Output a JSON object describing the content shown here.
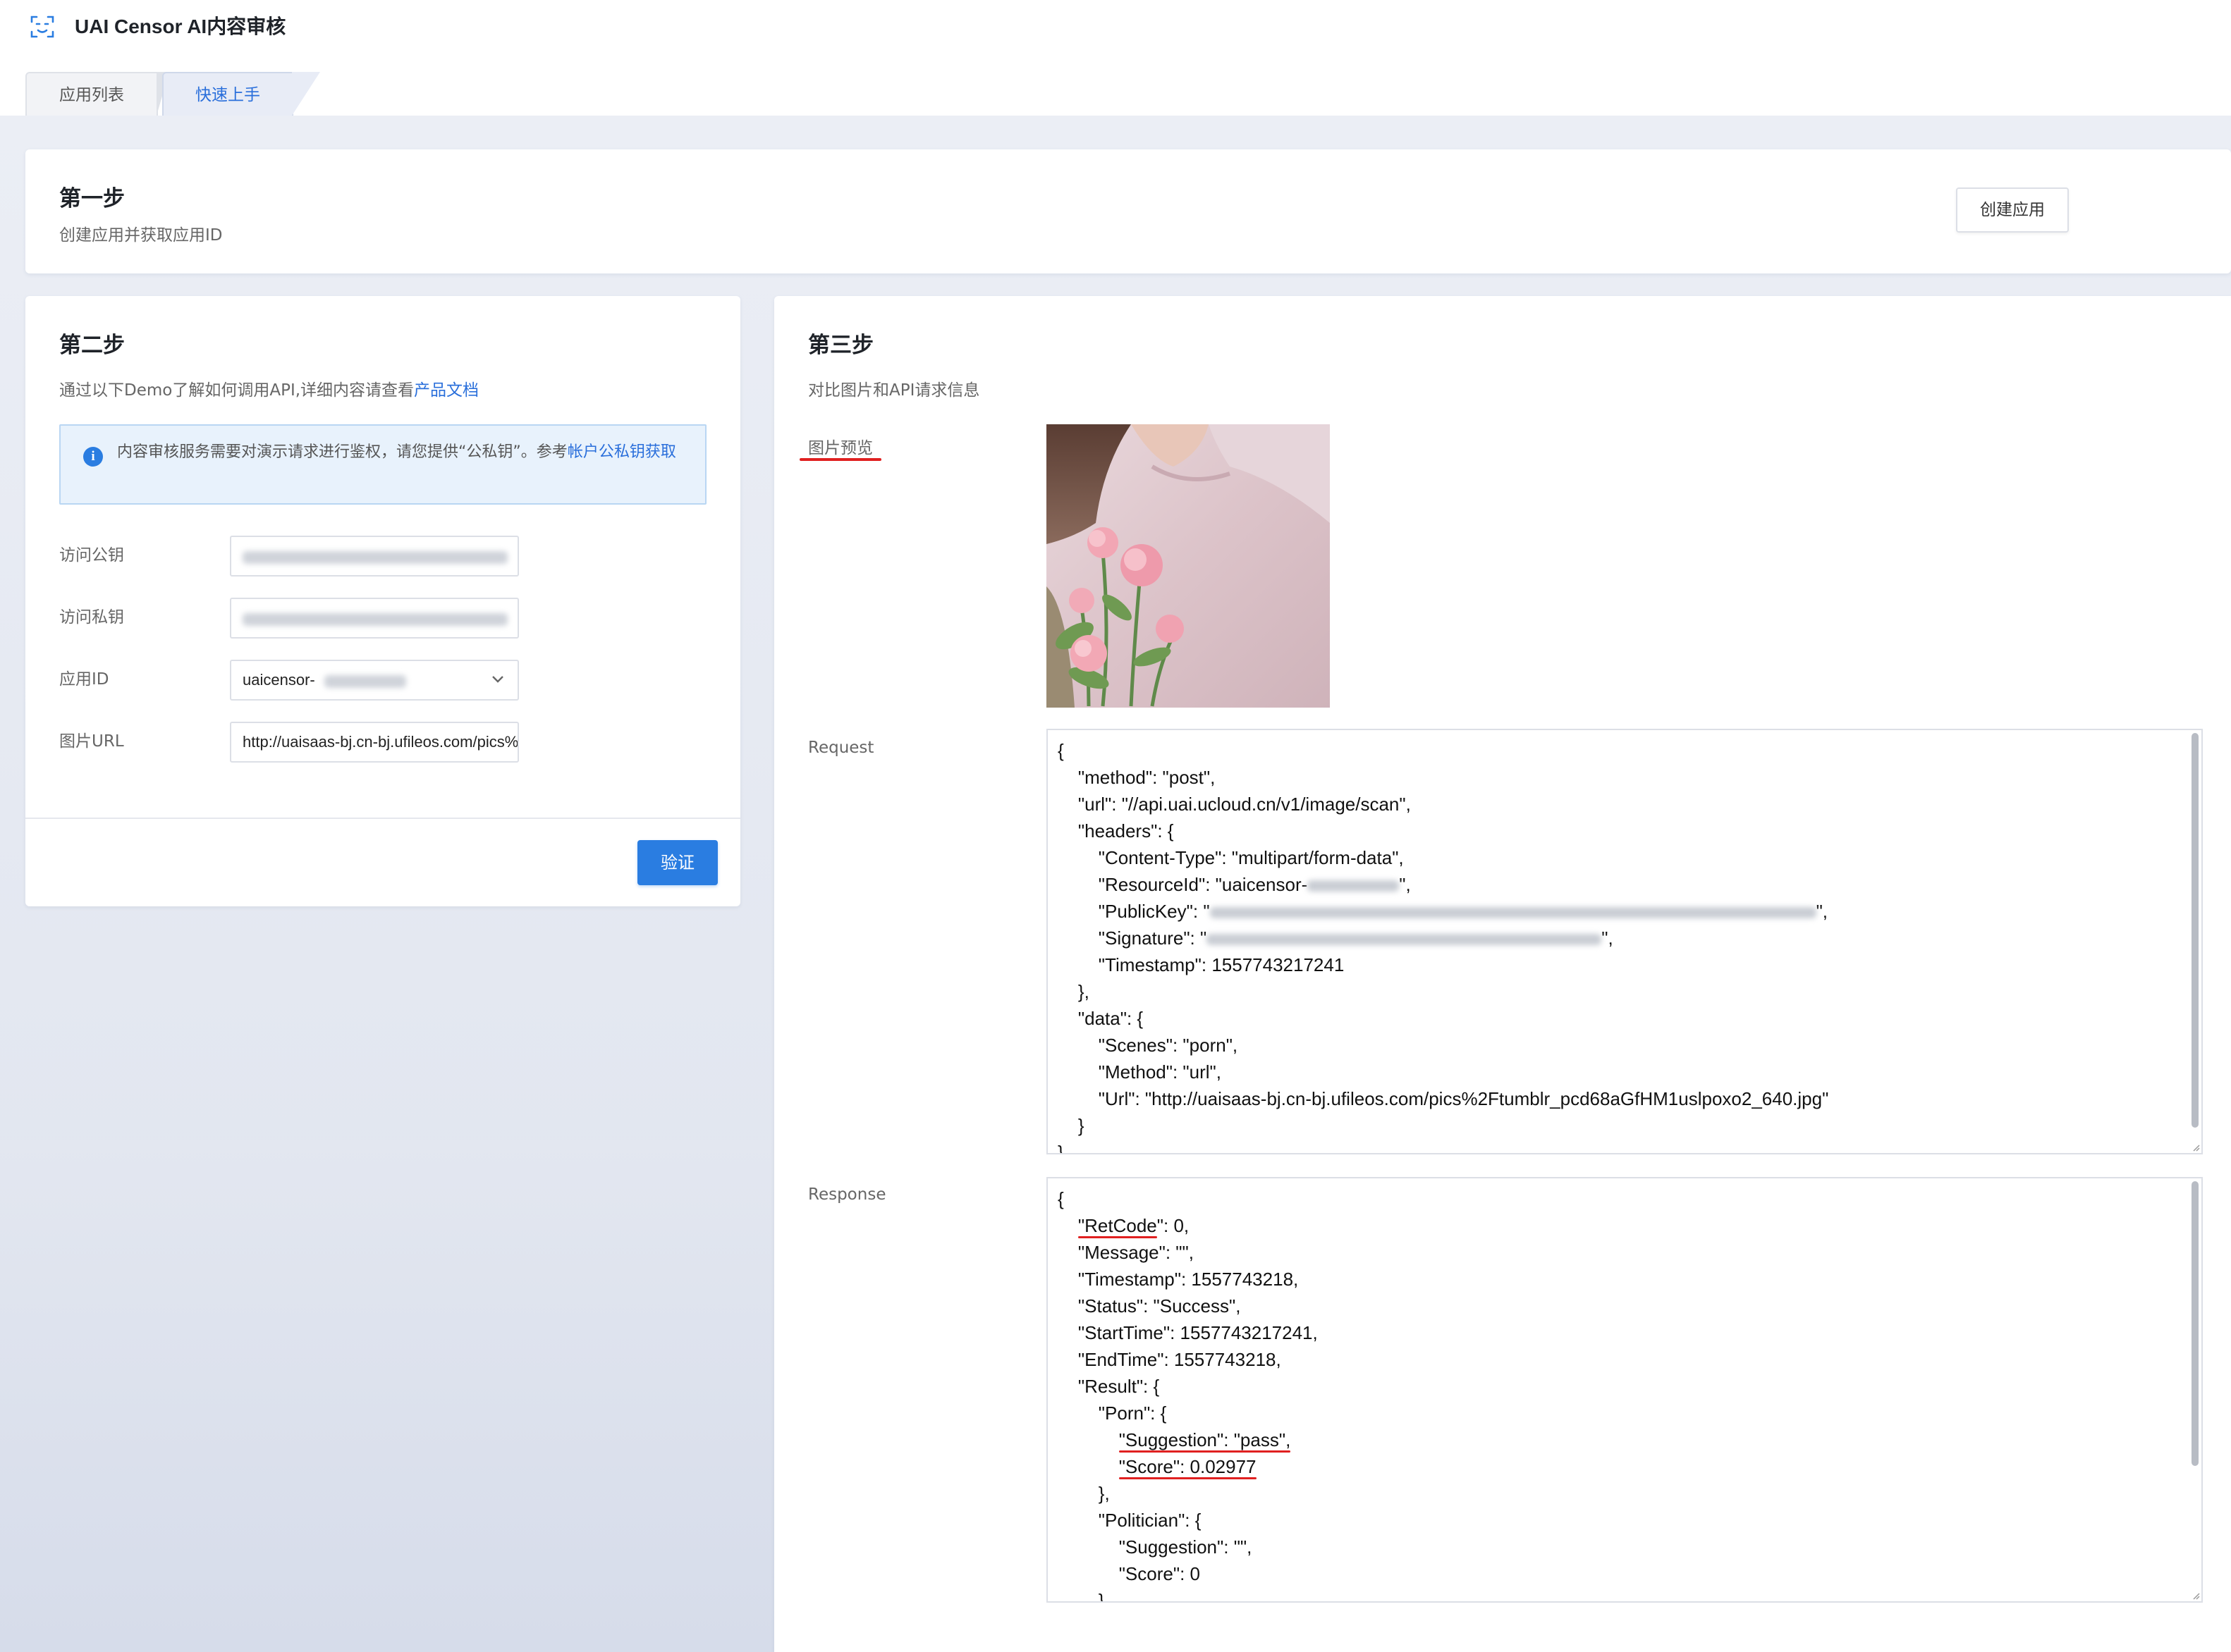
{
  "header": {
    "title": "UAI Censor AI内容审核",
    "tabs": [
      {
        "label": "应用列表",
        "active": false
      },
      {
        "label": "快速上手",
        "active": true
      }
    ]
  },
  "step1": {
    "title": "第一步",
    "subtitle": "创建应用并获取应用ID",
    "create_button": "创建应用"
  },
  "step2": {
    "title": "第二步",
    "subtitle_prefix": "通过以下Demo了解如何调用API,详细内容请查看",
    "subtitle_link": "产品文档",
    "info_text": "内容审核服务需要对演示请求进行鉴权，请您提供“公私钥”。参考",
    "info_link": "帐户公私钥获取",
    "fields": {
      "public_key_label": "访问公钥",
      "private_key_label": "访问私钥",
      "app_id_label": "应用ID",
      "app_id_value": "uaicensor-",
      "image_url_label": "图片URL",
      "image_url_value": "http://uaisaas-bj.cn-bj.ufileos.com/pics%2Ftumblr_pcd68aGfHM1uslpoxo2_640.jpg"
    },
    "verify_button": "验证"
  },
  "step3": {
    "title": "第三步",
    "subtitle": "对比图片和API请求信息",
    "preview_label": "图片预览",
    "request_label": "Request",
    "response_label": "Response",
    "request": {
      "open": "{",
      "method": "\"method\": \"post\",",
      "url": "\"url\": \"//api.uai.ucloud.cn/v1/image/scan\",",
      "headers_open": "\"headers\": {",
      "content_type": "\"Content-Type\": \"multipart/form-data\",",
      "resource_id_prefix": "\"ResourceId\": \"uaicensor-",
      "resource_id_suffix": "\",",
      "public_key_prefix": "\"PublicKey\": \"",
      "public_key_suffix": "\",",
      "signature_prefix": "\"Signature\": \"",
      "signature_suffix": "\",",
      "timestamp": "\"Timestamp\": 1557743217241",
      "headers_close": "},",
      "data_open": "\"data\": {",
      "scenes": "\"Scenes\": \"porn\",",
      "method2": "\"Method\": \"url\",",
      "url2": "\"Url\": \"http://uaisaas-bj.cn-bj.ufileos.com/pics%2Ftumblr_pcd68aGfHM1uslpoxo2_640.jpg\"",
      "data_close": "}",
      "close": "}"
    },
    "response": {
      "open": "{",
      "retcode_key": "\"RetCode",
      "retcode_rest": "\": 0,",
      "message": "\"Message\": \"\",",
      "timestamp": "\"Timestamp\": 1557743218,",
      "status": "\"Status\": \"Success\",",
      "start_time": "\"StartTime\": 1557743217241,",
      "end_time": "\"EndTime\": 1557743218,",
      "result_open": "\"Result\": {",
      "porn_open": "\"Porn\": {",
      "porn_suggestion": "\"Suggestion\": \"pass\",",
      "porn_score": "\"Score\": 0.02977",
      "porn_close": "},",
      "politician_open": "\"Politician\": {",
      "politician_suggestion": "\"Suggestion\": \"\",",
      "politician_score": "\"Score\": 0",
      "politician_close": "}"
    }
  },
  "colors": {
    "accent": "#2a7de1",
    "link": "#2a6fdb",
    "highlight_underline": "#e02020",
    "page_bg": "#ebeef5"
  },
  "icons": {
    "logo": "scan-face-icon",
    "info": "info-circle-icon",
    "dropdown": "chevron-down-icon"
  }
}
